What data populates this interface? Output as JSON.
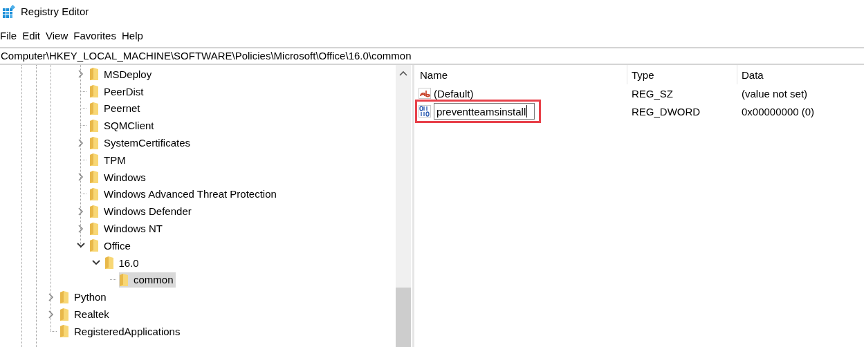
{
  "window": {
    "title": "Registry Editor"
  },
  "menu": [
    "File",
    "Edit",
    "View",
    "Favorites",
    "Help"
  ],
  "address": "Computer\\HKEY_LOCAL_MACHINE\\SOFTWARE\\Policies\\Microsoft\\Office\\16.0\\common",
  "tree": {
    "nested_items": [
      {
        "label": "MSDeploy",
        "kind": "collapsed",
        "selected": false
      },
      {
        "label": "PeerDist",
        "kind": "leaf",
        "selected": false
      },
      {
        "label": "Peernet",
        "kind": "leaf",
        "selected": false
      },
      {
        "label": "SQMClient",
        "kind": "leaf",
        "selected": false
      },
      {
        "label": "SystemCertificates",
        "kind": "collapsed",
        "selected": false
      },
      {
        "label": "TPM",
        "kind": "leaf",
        "selected": false
      },
      {
        "label": "Windows",
        "kind": "collapsed",
        "selected": false
      },
      {
        "label": "Windows Advanced Threat Protection",
        "kind": "leaf",
        "selected": false
      },
      {
        "label": "Windows Defender",
        "kind": "collapsed",
        "selected": false
      },
      {
        "label": "Windows NT",
        "kind": "collapsed",
        "selected": false
      },
      {
        "label": "Office",
        "kind": "expanded",
        "selected": false,
        "children": [
          {
            "label": "16.0",
            "kind": "expanded",
            "selected": false,
            "children": [
              {
                "label": "common",
                "kind": "leaf",
                "selected": true
              }
            ]
          }
        ]
      }
    ],
    "items": [
      {
        "label": "Python",
        "kind": "collapsed",
        "selected": false
      },
      {
        "label": "Realtek",
        "kind": "collapsed",
        "selected": false
      },
      {
        "label": "RegisteredApplications",
        "kind": "leaf",
        "selected": false
      }
    ]
  },
  "values": {
    "columns": [
      "Name",
      "Type",
      "Data"
    ],
    "rows": [
      {
        "kind": "string",
        "name": "(Default)",
        "type": "REG_SZ",
        "data": "(value not set)",
        "editing": false,
        "highlighted": false
      },
      {
        "kind": "dword",
        "name": "preventteamsinstall",
        "type": "REG_DWORD",
        "data": "0x00000000 (0)",
        "editing": true,
        "highlighted": true
      }
    ]
  }
}
